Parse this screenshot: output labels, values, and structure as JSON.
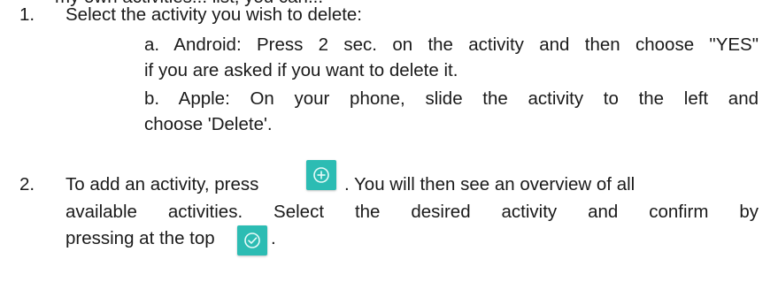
{
  "doc": {
    "top_cut_text": "my own activities... list, you can...",
    "step1": {
      "number": "1.",
      "text": "Select the activity you wish to delete:",
      "a": {
        "line1": "a. Android: Press 2 sec. on the activity and then choose \"YES\"",
        "line2": "if you are asked if you want to delete it."
      },
      "b": {
        "line1": "b. Apple: On your phone, slide the activity to the left and",
        "line2": "choose 'Delete'."
      }
    },
    "step2": {
      "number": "2.",
      "line1_pre": "To add an activity, press",
      "line1_post": ". You will then see an overview of all",
      "line2": "available activities. Select the desired activity and confirm by",
      "line3_pre": "pressing at the top",
      "line3_post": "."
    },
    "icons": {
      "add": "add-circle-icon",
      "confirm": "check-circle-icon",
      "button_color": "#2cbcb3"
    }
  }
}
